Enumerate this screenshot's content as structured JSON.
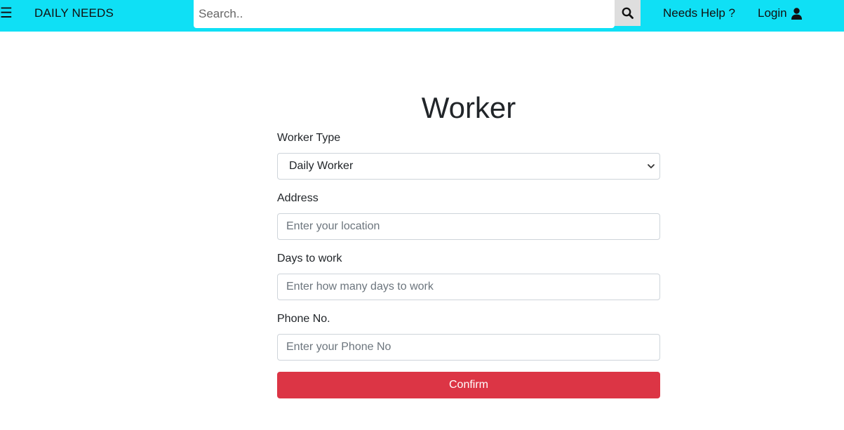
{
  "navbar": {
    "menu_icon": "hamburger-icon",
    "menu_glyph": "☰",
    "brand": "DAILY NEEDS",
    "search_placeholder": "Search..",
    "search_icon": "search-icon",
    "help_label": "Needs Help ?",
    "login_label": "Login",
    "login_icon": "user-icon",
    "bg_color": "#0fe0f5"
  },
  "form": {
    "title": "Worker",
    "worker_type": {
      "label": "Worker Type",
      "selected": "Daily Worker",
      "icon": "chevron-down-icon"
    },
    "address": {
      "label": "Address",
      "placeholder": "Enter your location",
      "value": ""
    },
    "days": {
      "label": "Days to work",
      "placeholder": "Enter how many days to work",
      "value": ""
    },
    "phone": {
      "label": "Phone No.",
      "placeholder": "Enter your Phone No",
      "value": ""
    },
    "confirm_label": "Confirm",
    "confirm_color": "#dc3545"
  }
}
